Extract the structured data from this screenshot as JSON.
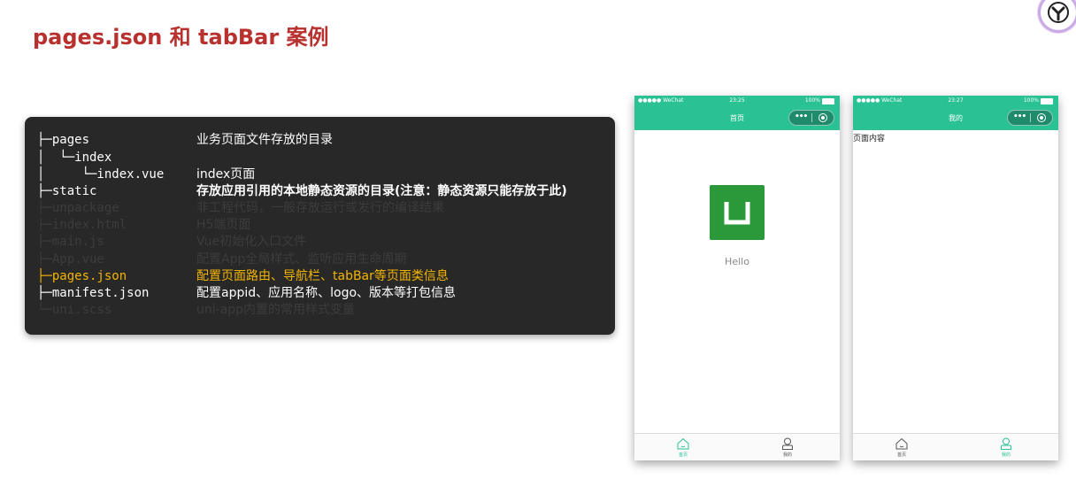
{
  "slide": {
    "title": "pages.json 和 tabBar 案例"
  },
  "code": {
    "rows": [
      {
        "tree": "├─pages",
        "desc": "业务页面文件存放的目录",
        "style": "active"
      },
      {
        "tree": "│  └─index",
        "desc": "",
        "style": "active"
      },
      {
        "tree": "│     └─index.vue",
        "desc": "index页面",
        "style": "active"
      },
      {
        "tree": "├─static",
        "desc": "存放应用引用的本地静态资源的目录(注意：静态资源只能存放于此)",
        "style": "active-bold"
      },
      {
        "tree": "├─unpackage",
        "desc": "非工程代码，一般存放运行或发行的编译结果",
        "style": "dim"
      },
      {
        "tree": "├─index.html",
        "desc": "H5端页面",
        "style": "dim"
      },
      {
        "tree": "├─main.js",
        "desc": "Vue初始化入口文件",
        "style": "dim"
      },
      {
        "tree": "├─App.vue",
        "desc": "配置App全局样式、监听应用生命周期",
        "style": "dim"
      },
      {
        "tree": "├─pages.json",
        "desc": "配置页面路由、导航栏、tabBar等页面类信息",
        "style": "highlight"
      },
      {
        "tree": "├─manifest.json",
        "desc": "配置appid、应用名称、logo、版本等打包信息",
        "style": "active"
      },
      {
        "tree": "└─uni.scss",
        "desc": "uni-app内置的常用样式变量",
        "style": "dim"
      }
    ]
  },
  "phones": [
    {
      "status": {
        "carrier": "●●●●● WeChat",
        "time": "23:25",
        "battery": "100%"
      },
      "nav_title": "首页",
      "hello": "Hello",
      "content": "",
      "tabs": [
        {
          "label": "首页",
          "active": true,
          "icon": "home-icon"
        },
        {
          "label": "我的",
          "active": false,
          "icon": "user-icon"
        }
      ]
    },
    {
      "status": {
        "carrier": "●●●●● WeChat",
        "time": "23:27",
        "battery": "100%"
      },
      "nav_title": "我的",
      "hello": "",
      "content": "页面内容",
      "tabs": [
        {
          "label": "首页",
          "active": false,
          "icon": "home-icon"
        },
        {
          "label": "我的",
          "active": true,
          "icon": "user-icon"
        }
      ]
    }
  ],
  "colors": {
    "title": "#b8312f",
    "nav_green": "#2ac195",
    "highlight": "#f4b400",
    "code_bg": "#282828"
  }
}
